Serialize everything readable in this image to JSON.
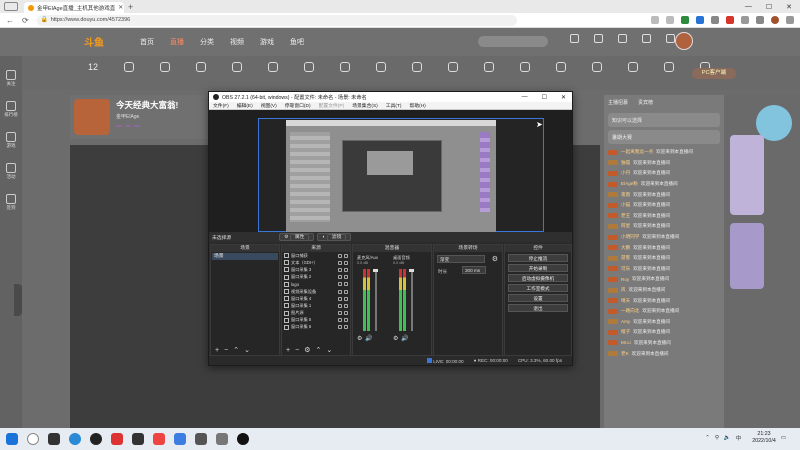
{
  "browser": {
    "tab_title": "金甲ElAge直播_主机其他游戏直",
    "url": "https://www.douyu.com/4572396"
  },
  "site": {
    "logo": "斗鱼",
    "nav": [
      "首页",
      "直播",
      "分类",
      "视频",
      "游戏",
      "鱼吧"
    ],
    "active_nav": "直播",
    "categories_count": "12",
    "pc_button": "PC客户端",
    "stream_title": "今天经典大富翁!",
    "streamer_name": "金甲ElAge",
    "left_items": [
      "关注",
      "排行榜",
      "游戏",
      "活动",
      "签到"
    ],
    "right_tabs": [
      "主播招募",
      "贵宾榜"
    ],
    "notice1": "知识可以选择",
    "notice2": "暑期大赛",
    "chat": [
      {
        "user": "一起离我远一点",
        "text": "欢迎来到本直播间"
      },
      {
        "user": "独孤",
        "text": "欢迎来到本直播间"
      },
      {
        "user": "小丹",
        "text": "欢迎来到本直播间"
      },
      {
        "user": "ElAge粉",
        "text": "欢迎来到本直播间"
      },
      {
        "user": "夜雨",
        "text": "欢迎来到本直播间"
      },
      {
        "user": "小猫",
        "text": "欢迎来到本直播间"
      },
      {
        "user": "老王",
        "text": "欢迎来到本直播间"
      },
      {
        "user": "阿星",
        "text": "欢迎来到本直播间"
      },
      {
        "user": "小明同学",
        "text": "欢迎来到本直播间"
      },
      {
        "user": "大鹏",
        "text": "欢迎来到本直播间"
      },
      {
        "user": "游客",
        "text": "欢迎来到本直播间"
      },
      {
        "user": "可乐",
        "text": "欢迎来到本直播间"
      },
      {
        "user": "Roy",
        "text": "欢迎来到本直播间"
      },
      {
        "user": "风",
        "text": "欢迎来到本直播间"
      },
      {
        "user": "晴天",
        "text": "欢迎来到本直播间"
      },
      {
        "user": "一路向北",
        "text": "欢迎来到本直播间"
      },
      {
        "user": "Amy",
        "text": "欢迎来到本直播间"
      },
      {
        "user": "橙子",
        "text": "欢迎来到本直播间"
      },
      {
        "user": "Mr.Li",
        "text": "欢迎来到本直播间"
      },
      {
        "user": "老K",
        "text": "欢迎来到本直播间"
      }
    ]
  },
  "obs": {
    "title": "OBS 27.2.1 (64-bit, windows) - 配置文件: 未命名 - 场景: 未命名",
    "menu": [
      "文件(F)",
      "编辑(E)",
      "视图(V)",
      "停靠窗口(D)",
      "配置文件(P)",
      "场景集合(S)",
      "工具(T)",
      "帮助(H)"
    ],
    "current_scene_label": "未选择源",
    "scene_props_btn": "属性",
    "scene_filter_btn": "滤镜",
    "docks": {
      "scenes": "场景",
      "sources": "来源",
      "mixer": "混音器",
      "transitions": "场景转场",
      "controls": "控件"
    },
    "scene_items": [
      "场景"
    ],
    "sources": [
      "窗口捕获",
      "文本（GDI+）",
      "窗口采集 3",
      "窗口采集 2",
      "logo",
      "视频采集设备",
      "窗口采集 4",
      "窗口采集 1",
      "图片源",
      "窗口采集 5",
      "窗口采集 6"
    ],
    "mixer": [
      {
        "name": "麦克风/Aux",
        "db": "0.0 dB"
      },
      {
        "name": "桌面音频",
        "db": "0.0 dB"
      }
    ],
    "transition": {
      "type": "渐变",
      "duration_label": "时长",
      "duration_value": "300 ms"
    },
    "controls": [
      "停止推流",
      "开始录制",
      "启动虚拟摄像机",
      "工作室模式",
      "设置",
      "退出"
    ],
    "status": {
      "live": "LIVE: 00:00:00",
      "rec": "REC: 00:00:00",
      "cpu": "CPU: 3.3%, 60.00 fps"
    }
  },
  "taskbar": {
    "time": "21:23",
    "date": "2022/10/4"
  }
}
